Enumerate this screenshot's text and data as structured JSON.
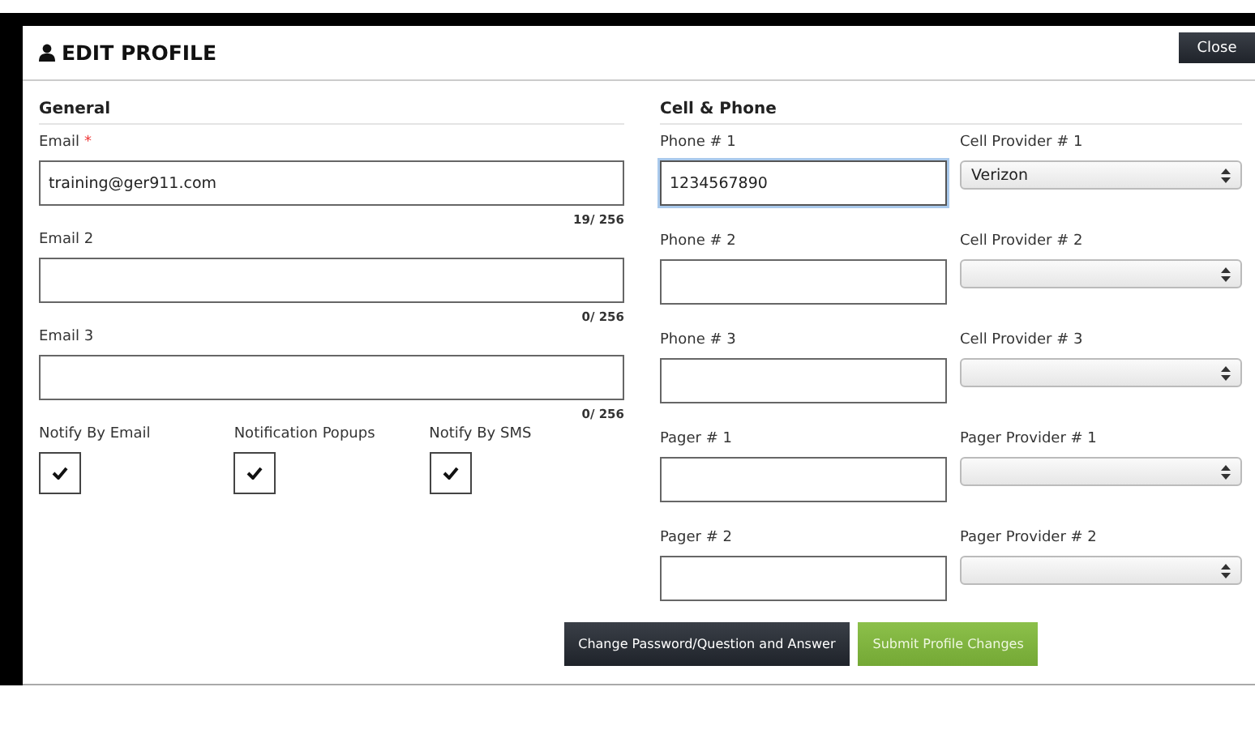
{
  "modal": {
    "title": "EDIT PROFILE",
    "close_button": "Close"
  },
  "general": {
    "heading": "General",
    "emails": [
      {
        "label": "Email",
        "required": true,
        "required_mark": "*",
        "value": "training@ger911.com",
        "count": "19/ 256"
      },
      {
        "label": "Email 2",
        "required": false,
        "count": "0/ 256"
      },
      {
        "label": "Email 3",
        "required": false,
        "count": "0/ 256"
      }
    ],
    "notifications": [
      {
        "label": "Notify By Email",
        "checked": true
      },
      {
        "label": "Notification Popups",
        "checked": true
      },
      {
        "label": "Notify By SMS",
        "checked": true
      }
    ]
  },
  "cell_phone": {
    "heading": "Cell & Phone",
    "rows": [
      {
        "number_label": "Phone # 1",
        "number_value": "1234567890",
        "focused": true,
        "provider_label": "Cell Provider # 1",
        "provider_value": "Verizon"
      },
      {
        "number_label": "Phone # 2",
        "focused": false,
        "provider_label": "Cell Provider # 2"
      },
      {
        "number_label": "Phone # 3",
        "focused": false,
        "provider_label": "Cell Provider # 3"
      },
      {
        "number_label": "Pager # 1",
        "focused": false,
        "provider_label": "Pager Provider # 1"
      },
      {
        "number_label": "Pager # 2",
        "focused": false,
        "provider_label": "Pager Provider # 2"
      }
    ]
  },
  "buttons": [
    {
      "label": "Change Password/Question and Answer",
      "kind": "dark"
    },
    {
      "label": "Submit Profile Changes",
      "kind": "green"
    }
  ]
}
